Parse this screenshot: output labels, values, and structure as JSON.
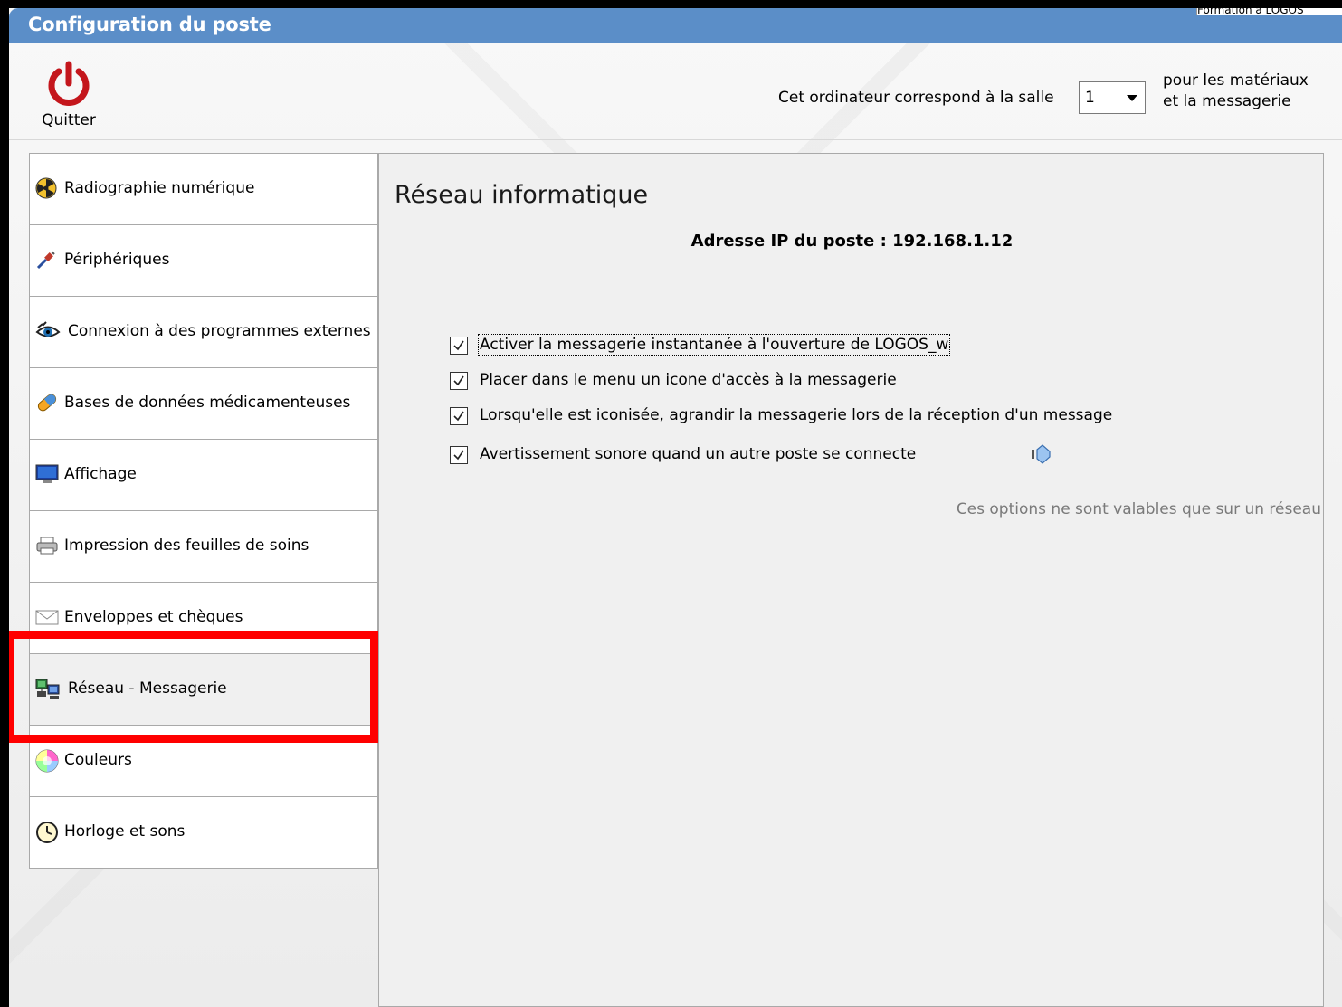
{
  "window": {
    "title": "Configuration du poste",
    "corner_tab_text": "Formation à LOGOS"
  },
  "toolbar": {
    "quit_label": "Quitter",
    "quit_icon": "power-icon",
    "room_label": "Cet ordinateur correspond à la salle",
    "room_value": "1",
    "room_suffix_line1": "pour les matériaux",
    "room_suffix_line2": "et la messagerie"
  },
  "sidebar": {
    "items": [
      {
        "label": "Radiographie numérique",
        "icon": "radiation-icon"
      },
      {
        "label": "Périphériques",
        "icon": "plug-icon"
      },
      {
        "label": "Connexion à des programmes externes",
        "icon": "eye-icon"
      },
      {
        "label": "Bases de données médicamenteuses",
        "icon": "pill-icon"
      },
      {
        "label": "Affichage",
        "icon": "monitor-icon"
      },
      {
        "label": "Impression des feuilles de soins",
        "icon": "printer-icon"
      },
      {
        "label": "Enveloppes et chèques",
        "icon": "envelope-icon"
      },
      {
        "label": "Réseau - Messagerie",
        "icon": "network-icon",
        "selected": true
      },
      {
        "label": "Couleurs",
        "icon": "color-wheel-icon"
      },
      {
        "label": "Horloge et sons",
        "icon": "clock-icon"
      }
    ],
    "highlight_color": "#ff0000"
  },
  "panel": {
    "title": "Réseau informatique",
    "ip_line": "Adresse IP du poste : 192.168.1.12",
    "options": [
      {
        "label": "Activer la messagerie instantanée à l'ouverture de LOGOS_w",
        "checked": true
      },
      {
        "label": "Placer dans le menu un icone d'accès à la messagerie",
        "checked": true
      },
      {
        "label": "Lorsqu'elle est iconisée, agrandir la messagerie lors de la réception d'un message",
        "checked": true
      },
      {
        "label": "Avertissement sonore quand un autre poste se connecte",
        "checked": true
      }
    ],
    "speaker_icon": "speaker-icon",
    "note": "Ces options ne sont valables que sur un réseau"
  },
  "colors": {
    "titlebar": "#5b8ec8",
    "highlight": "#ff0000",
    "quit_icon": "#c4161c"
  }
}
